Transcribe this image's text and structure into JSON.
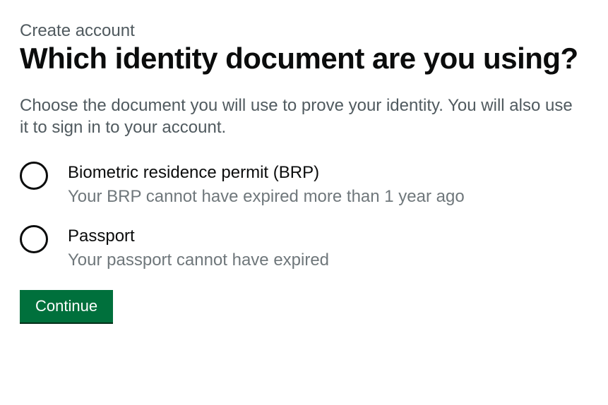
{
  "caption": "Create account",
  "heading": "Which identity document are you using?",
  "description": "Choose the document you will use to prove your identity. You will also use it to sign in to your account.",
  "options": [
    {
      "label": "Biometric residence permit (BRP)",
      "hint": "Your BRP cannot have expired more than 1 year ago"
    },
    {
      "label": "Passport",
      "hint": "Your passport cannot have expired"
    }
  ],
  "continue_label": "Continue"
}
